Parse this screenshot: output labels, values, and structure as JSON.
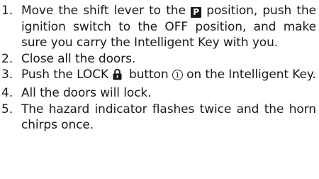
{
  "steps": [
    {
      "number": "1.",
      "text_before_badge": "Move the shift lever to the ",
      "badge": "P",
      "text_after_badge": " position, push the ignition switch to the OFF position, and make sure you carry the Intelligent Key with you."
    },
    {
      "number": "2.",
      "text": "Close all the doors."
    },
    {
      "number": "3.",
      "text_before_icon": "Push the LOCK",
      "icon": "padlock-icon",
      "text_after_icon": "button ",
      "callout": "1",
      "text_after_callout": " on the Intelligent Key."
    },
    {
      "number": "4.",
      "text": "All the doors will lock."
    },
    {
      "number": "5.",
      "text": "The hazard indicator flashes twice and the horn chirps once."
    }
  ]
}
